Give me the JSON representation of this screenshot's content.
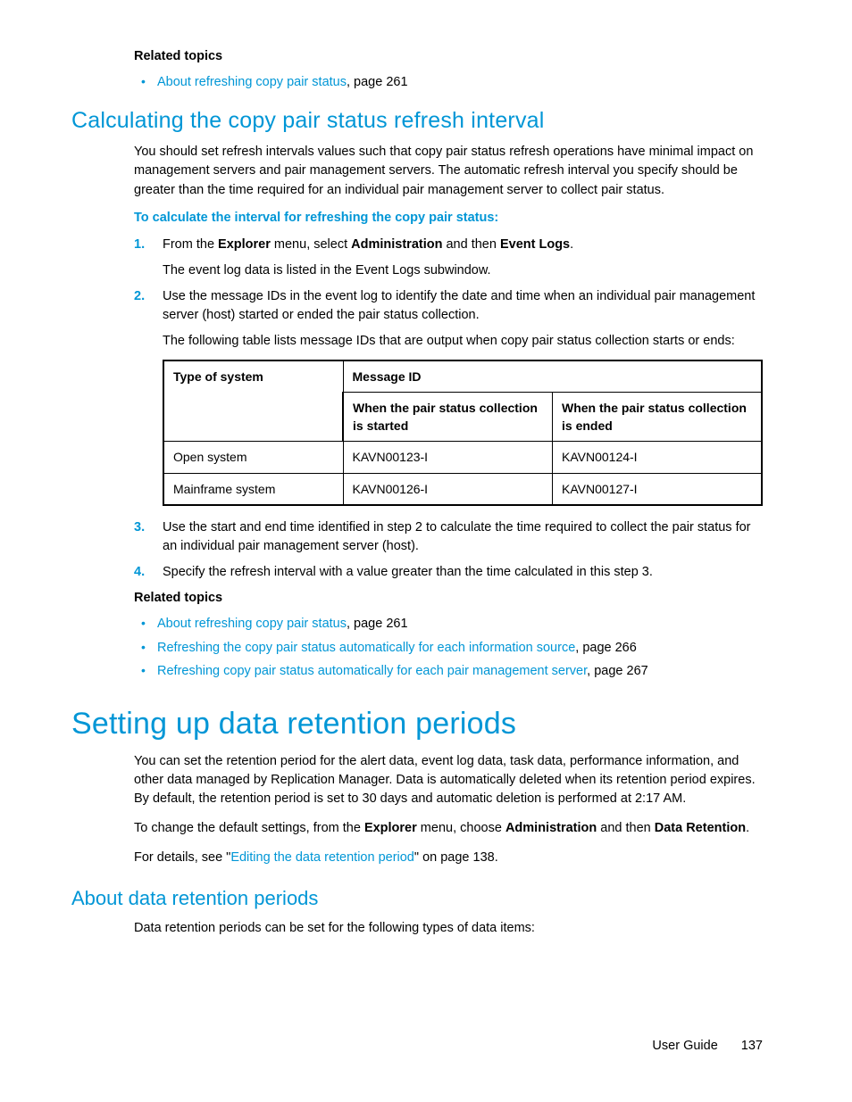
{
  "related1": {
    "heading": "Related topics",
    "items": [
      {
        "link": "About refreshing copy pair status",
        "suffix": ", page 261"
      }
    ]
  },
  "section1": {
    "title": "Calculating the copy pair status refresh interval",
    "intro": "You should set refresh intervals values such that copy pair status refresh operations have minimal impact on management servers and pair management servers. The automatic refresh interval you specify should be greater than the time required for an individual pair management server to collect pair status.",
    "instruction": "To calculate the interval for refreshing the copy pair status:",
    "steps": {
      "s1": {
        "text_a": "From the ",
        "b1": "Explorer",
        "text_b": " menu, select ",
        "b2": "Administration",
        "text_c": " and then ",
        "b3": "Event Logs",
        "text_d": ".",
        "sub": "The event log data is listed in the Event Logs subwindow."
      },
      "s2": {
        "text": "Use the message IDs in the event log to identify the date and time when an individual pair management server (host) started or ended the pair status collection.",
        "sub": "The following table lists message IDs that are output when copy pair status collection starts or ends:"
      },
      "s3": {
        "text": "Use the start and end time identified in step 2 to calculate the time required to collect the pair status for an individual pair management server (host)."
      },
      "s4": {
        "text": "Specify the refresh interval with a value greater than the time calculated in this step 3."
      }
    },
    "table": {
      "h_type": "Type of system",
      "h_msgid": "Message ID",
      "h_start": "When the pair status collection is started",
      "h_end": "When the pair status collection is ended",
      "rows": [
        {
          "type": "Open system",
          "start": "KAVN00123-I",
          "end": "KAVN00124-I"
        },
        {
          "type": "Mainframe system",
          "start": "KAVN00126-I",
          "end": "KAVN00127-I"
        }
      ]
    }
  },
  "related2": {
    "heading": "Related topics",
    "items": [
      {
        "link": "About refreshing copy pair status",
        "suffix": ", page 261"
      },
      {
        "link": "Refreshing the copy pair status automatically for each information source",
        "suffix": ", page 266"
      },
      {
        "link": "Refreshing copy pair status automatically for each pair management server",
        "suffix": ", page 267"
      }
    ]
  },
  "section2": {
    "title": "Setting up data retention periods",
    "p1": "You can set the retention period for the alert data, event log data, task data, performance information, and other data managed by Replication Manager. Data is automatically deleted when its retention period expires. By default, the retention period is set to 30 days and automatic deletion is performed at 2:17 AM.",
    "p2": {
      "a": "To change the default settings, from the ",
      "b1": "Explorer",
      "b": " menu, choose ",
      "b2": "Administration",
      "c": " and then ",
      "b3": "Data Retention",
      "d": "."
    },
    "p3": {
      "a": "For details, see \"",
      "link": "Editing the data retention period",
      "b": "\" on page 138."
    },
    "sub_title": "About data retention periods",
    "p4": "Data retention periods can be set for the following types of data items:"
  },
  "footer": {
    "label": "User Guide",
    "page": "137"
  }
}
